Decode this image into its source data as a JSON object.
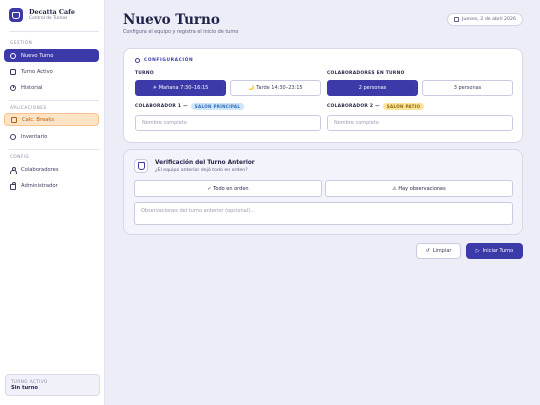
{
  "brand": {
    "name": "Decatta Cafe",
    "subtitle": "Control de Turnos"
  },
  "sidebar": {
    "sections": [
      {
        "label": "GESTIÓN"
      },
      {
        "label": "APLICACIONES"
      },
      {
        "label": "CONFIG"
      }
    ],
    "items": [
      {
        "label": "Nuevo Turno",
        "icon": "plus-circle-icon",
        "state": "active"
      },
      {
        "label": "Turno Activo",
        "icon": "checkbox-icon",
        "state": "normal"
      },
      {
        "label": "Historial",
        "icon": "clock-icon",
        "state": "normal"
      },
      {
        "label": "Calc. Breaks",
        "icon": "calculator-icon",
        "state": "warning"
      },
      {
        "label": "Inventario",
        "icon": "box-icon",
        "state": "normal"
      },
      {
        "label": "Colaboradores",
        "icon": "users-icon",
        "state": "normal"
      },
      {
        "label": "Administrador",
        "icon": "lock-icon",
        "state": "normal"
      }
    ],
    "turno_activo": {
      "label": "TURNO ACTIVO",
      "value": "Sin turno"
    }
  },
  "header": {
    "title": "Nuevo Turno",
    "subtitle": "Configura el equipo y registra el inicio de turno",
    "date": "Jueves, 2 de abril 2026"
  },
  "config": {
    "section_label": "CONFIGURACIÓN",
    "turno_label": "TURNO",
    "turno_options": [
      {
        "label": "☀ Mañana 7:30–16:15",
        "selected": true
      },
      {
        "label": "🌙 Tarde 14:30–23:15",
        "selected": false
      }
    ],
    "colab_count_label": "COLABORADORES EN TURNO",
    "colab_count_options": [
      {
        "label": "2 personas",
        "selected": true
      },
      {
        "label": "3 personas",
        "selected": false
      }
    ],
    "collab1": {
      "label": "COLABORADOR 1 —",
      "badge": "SALÓN PRINCIPAL",
      "placeholder": "Nombre completo"
    },
    "collab2": {
      "label": "COLABORADOR 2 —",
      "badge": "SALÓN PATIO",
      "placeholder": "Nombre completo"
    }
  },
  "verificacion": {
    "title": "Verificación del Turno Anterior",
    "subtitle": "¿El equipo anterior dejó todo en orden?",
    "ok_label": "✓ Todo en orden",
    "obs_label": "⚠ Hay observaciones",
    "textarea_placeholder": "Observaciones del turno anterior (opcional)..."
  },
  "actions": {
    "clear_label": "Limpiar",
    "start_label": "Iniciar Turno"
  },
  "colors": {
    "accent": "#3b3aa8",
    "warning_bg": "#fde4c6",
    "background": "#ecedf7"
  }
}
